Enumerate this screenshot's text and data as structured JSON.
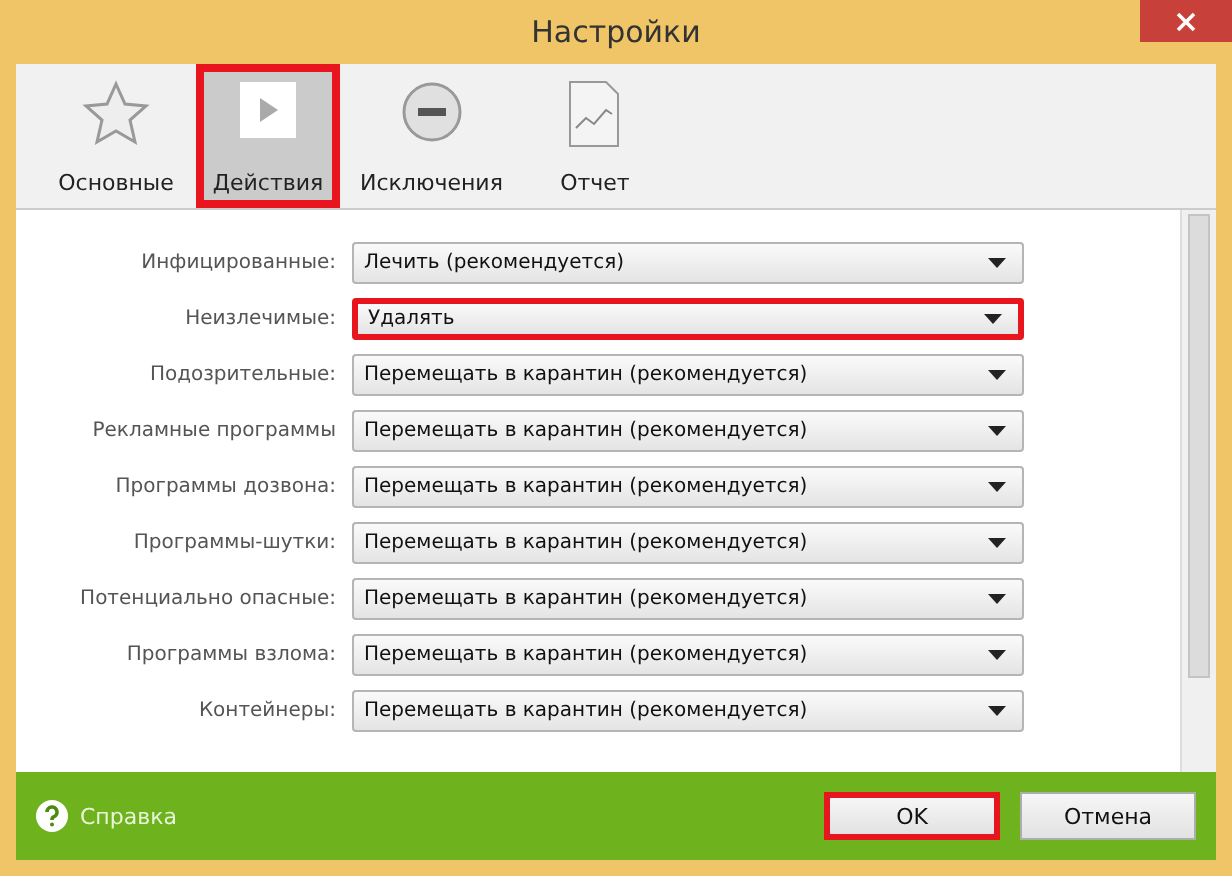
{
  "window": {
    "title": "Настройки"
  },
  "tabs": [
    {
      "label": "Основные",
      "kind": "star",
      "selected": false,
      "highlighted": false
    },
    {
      "label": "Действия",
      "kind": "play",
      "selected": true,
      "highlighted": true
    },
    {
      "label": "Исключения",
      "kind": "minus",
      "selected": false,
      "highlighted": false
    },
    {
      "label": "Отчет",
      "kind": "report",
      "selected": false,
      "highlighted": false
    }
  ],
  "rows": [
    {
      "label": "Инфицированные:",
      "value": "Лечить (рекомендуется)",
      "highlighted": false
    },
    {
      "label": "Неизлечимые:",
      "value": "Удалять",
      "highlighted": true
    },
    {
      "label": "Подозрительные:",
      "value": "Перемещать в карантин (рекомендуется)",
      "highlighted": false
    },
    {
      "label": "Рекламные программы",
      "value": "Перемещать в карантин (рекомендуется)",
      "highlighted": false
    },
    {
      "label": "Программы дозвона:",
      "value": "Перемещать в карантин (рекомендуется)",
      "highlighted": false
    },
    {
      "label": "Программы-шутки:",
      "value": "Перемещать в карантин (рекомендуется)",
      "highlighted": false
    },
    {
      "label": "Потенциально опасные:",
      "value": "Перемещать в карантин (рекомендуется)",
      "highlighted": false
    },
    {
      "label": "Программы взлома:",
      "value": "Перемещать в карантин (рекомендуется)",
      "highlighted": false
    },
    {
      "label": "Контейнеры:",
      "value": "Перемещать в карантин (рекомендуется)",
      "highlighted": false
    }
  ],
  "footer": {
    "help": "Справка",
    "buttons": [
      {
        "label": "OK",
        "highlighted": true
      },
      {
        "label": "Отмена",
        "highlighted": false
      }
    ]
  }
}
